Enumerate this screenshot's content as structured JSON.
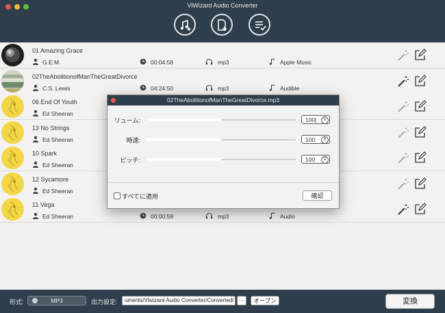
{
  "window": {
    "title": "ViWizard Audio Converter"
  },
  "colors": {
    "titlebar": "#2f3e4c",
    "close": "#e9574b",
    "minimize": "#f2b93b",
    "zoom": "#5bc236"
  },
  "toolbar": [
    {
      "icon": "add-music-icon"
    },
    {
      "icon": "add-file-icon"
    },
    {
      "icon": "converted-list-icon"
    }
  ],
  "tracks": [
    {
      "title": "01 Amazing Grace",
      "artist": "G.E.M.",
      "duration": "00:04:58",
      "format": "mp3",
      "source": "Apple Music",
      "cover": "dark"
    },
    {
      "title": "02TheAbolitionofManTheGreatDivorce",
      "artist": "C.S. Lewis",
      "duration": "04:24:50",
      "format": "mp3",
      "source": "Audible",
      "cover": "book"
    },
    {
      "title": "06 End Of Youth",
      "artist": "Ed Sheeran",
      "duration": "",
      "format": "",
      "source": "",
      "cover": "yellow"
    },
    {
      "title": "13 No Strings",
      "artist": "Ed Sheeran",
      "duration": "",
      "format": "",
      "source": "",
      "cover": "yellow"
    },
    {
      "title": "10 Spark",
      "artist": "Ed Sheeran",
      "duration": "",
      "format": "",
      "source": "",
      "cover": "yellow"
    },
    {
      "title": "12 Sycamore",
      "artist": "Ed Sheeran",
      "duration": "",
      "format": "",
      "source": "",
      "cover": "yellow"
    },
    {
      "title": "11 Vega",
      "artist": "Ed Sheeran",
      "duration": "00:00:59",
      "format": "mp3",
      "source": "Audio",
      "cover": "yellow"
    }
  ],
  "dialog": {
    "title": "02TheAbolitionofManTheGreatDivorce.mp3",
    "sliders": [
      {
        "label": "リューム:",
        "value": "100|",
        "level": 0.5
      },
      {
        "label": "時速:",
        "value": "100",
        "level": 0.5
      },
      {
        "label": "ピッチ:",
        "value": "100",
        "level": 0.5
      }
    ],
    "apply_all_label": "すべてに適用",
    "confirm_label": "確認"
  },
  "footer": {
    "format_label": "形式:",
    "format_value": "MP3",
    "output_label": "出力設定:",
    "output_path": "uments/Viwizard Audio Converter/Converted/",
    "browse_label": "···",
    "open_label": "オープン",
    "convert_label": "変換"
  }
}
